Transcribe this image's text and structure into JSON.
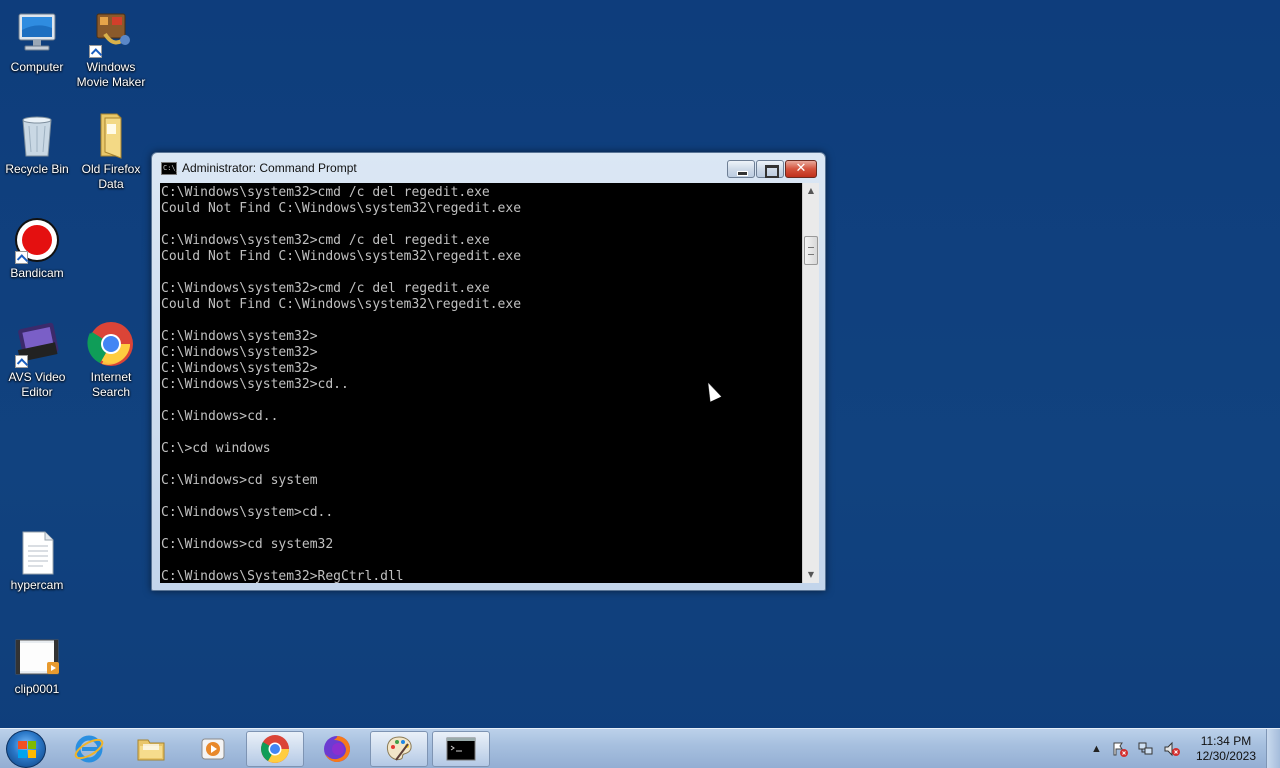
{
  "desktop": {
    "icons": [
      {
        "id": "computer",
        "label_lines": [
          "Computer",
          ""
        ]
      },
      {
        "id": "movie-maker",
        "label_lines": [
          "Windows",
          "Movie Maker"
        ]
      },
      {
        "id": "recycle-bin",
        "label_lines": [
          "Recycle Bin",
          ""
        ]
      },
      {
        "id": "old-firefox",
        "label_lines": [
          "Old Firefox",
          "Data"
        ]
      },
      {
        "id": "bandicam",
        "label_lines": [
          "Bandicam",
          ""
        ]
      },
      {
        "id": "avs",
        "label_lines": [
          "AVS Video",
          "Editor"
        ]
      },
      {
        "id": "internet-search",
        "label_lines": [
          "Internet",
          "Search"
        ]
      },
      {
        "id": "hypercam",
        "label_lines": [
          "hypercam",
          ""
        ]
      },
      {
        "id": "clip0001",
        "label_lines": [
          "clip0001",
          ""
        ]
      }
    ]
  },
  "window": {
    "title": "Administrator:  Command Prompt",
    "title_icon_text": "C:\\_",
    "close_glyph": "✕",
    "scroll_up": "▲",
    "scroll_down": "▼",
    "lines": [
      "C:\\Windows\\system32>cmd /c del regedit.exe",
      "Could Not Find C:\\Windows\\system32\\regedit.exe",
      "",
      "C:\\Windows\\system32>cmd /c del regedit.exe",
      "Could Not Find C:\\Windows\\system32\\regedit.exe",
      "",
      "C:\\Windows\\system32>cmd /c del regedit.exe",
      "Could Not Find C:\\Windows\\system32\\regedit.exe",
      "",
      "C:\\Windows\\system32>",
      "C:\\Windows\\system32>",
      "C:\\Windows\\system32>",
      "C:\\Windows\\system32>cd..",
      "",
      "C:\\Windows>cd..",
      "",
      "C:\\>cd windows",
      "",
      "C:\\Windows>cd system",
      "",
      "C:\\Windows\\system>cd..",
      "",
      "C:\\Windows>cd system32",
      "",
      "C:\\Windows\\System32>RegCtrl.dll"
    ]
  },
  "taskbar": {
    "items": [
      "internet-explorer",
      "file-explorer",
      "media-player",
      "chrome",
      "firefox",
      "paint",
      "command-prompt"
    ],
    "tray": {
      "show_hidden_glyph": "▲",
      "time": "11:34 PM",
      "date": "12/30/2023"
    }
  },
  "colors": {
    "desktop_bg": "#0f3f7f",
    "console_bg": "#000000",
    "console_text": "#c0c0c0"
  }
}
